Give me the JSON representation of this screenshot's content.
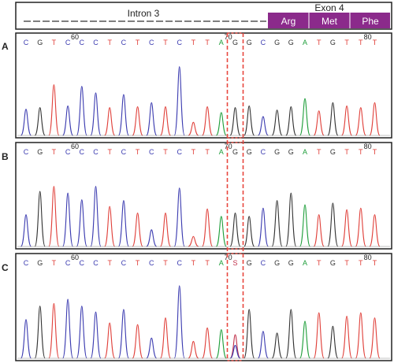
{
  "gene_map": {
    "intron_label": "Intron 3",
    "exon_label": "Exon 4",
    "codons": [
      "Arg",
      "Met",
      "Phe"
    ],
    "exon_color": "#8b2a8b"
  },
  "base_colors": {
    "C": "#3b3bb0",
    "G": "#333333",
    "T": "#e0403a",
    "A": "#1e9e3a",
    "S": "#c0304a"
  },
  "marker_color": "#e8463e",
  "panels": [
    {
      "label": "A",
      "sequence": [
        "C",
        "G",
        "T",
        "C",
        "C",
        "C",
        "T",
        "C",
        "T",
        "C",
        "T",
        "C",
        "T",
        "T",
        "A",
        "G",
        "G",
        "C",
        "G",
        "G",
        "A",
        "T",
        "G",
        "T",
        "T",
        "T"
      ],
      "tick_labels": [
        {
          "after_base": 3,
          "text": "60"
        },
        {
          "after_base": 14,
          "text": "70"
        },
        {
          "after_base": 24,
          "text": "80"
        }
      ],
      "peak_heights": [
        0.32,
        0.34,
        0.62,
        0.36,
        0.6,
        0.52,
        0.34,
        0.5,
        0.35,
        0.4,
        0.35,
        0.84,
        0.16,
        0.35,
        0.28,
        0.34,
        0.36,
        0.23,
        0.31,
        0.35,
        0.45,
        0.3,
        0.4,
        0.36,
        0.34,
        0.4
      ]
    },
    {
      "label": "B",
      "sequence": [
        "C",
        "G",
        "T",
        "C",
        "C",
        "C",
        "T",
        "C",
        "T",
        "C",
        "T",
        "C",
        "T",
        "T",
        "A",
        "G",
        "G",
        "C",
        "G",
        "G",
        "A",
        "T",
        "G",
        "T",
        "T",
        "T"
      ],
      "tick_labels": [
        {
          "after_base": 3,
          "text": "60"
        },
        {
          "after_base": 14,
          "text": "70"
        },
        {
          "after_base": 24,
          "text": "80"
        }
      ],
      "peak_heights": [
        0.38,
        0.66,
        0.72,
        0.64,
        0.56,
        0.72,
        0.48,
        0.55,
        0.4,
        0.2,
        0.4,
        0.7,
        0.12,
        0.45,
        0.36,
        0.4,
        0.36,
        0.46,
        0.55,
        0.64,
        0.5,
        0.38,
        0.52,
        0.44,
        0.46,
        0.38
      ]
    },
    {
      "label": "C",
      "sequence": [
        "C",
        "G",
        "T",
        "C",
        "C",
        "C",
        "T",
        "C",
        "T",
        "C",
        "T",
        "C",
        "T",
        "T",
        "A",
        "S",
        "G",
        "C",
        "G",
        "G",
        "A",
        "T",
        "G",
        "T",
        "T",
        "T"
      ],
      "tick_labels": [
        {
          "after_base": 3,
          "text": "60"
        },
        {
          "after_base": 14,
          "text": "70"
        },
        {
          "after_base": 24,
          "text": "80"
        }
      ],
      "peak_heights": [
        0.46,
        0.62,
        0.65,
        0.7,
        0.62,
        0.55,
        0.42,
        0.58,
        0.4,
        0.24,
        0.48,
        0.86,
        0.2,
        0.36,
        0.34,
        0.28,
        0.58,
        0.32,
        0.3,
        0.58,
        0.44,
        0.54,
        0.38,
        0.5,
        0.54,
        0.48
      ]
    }
  ]
}
